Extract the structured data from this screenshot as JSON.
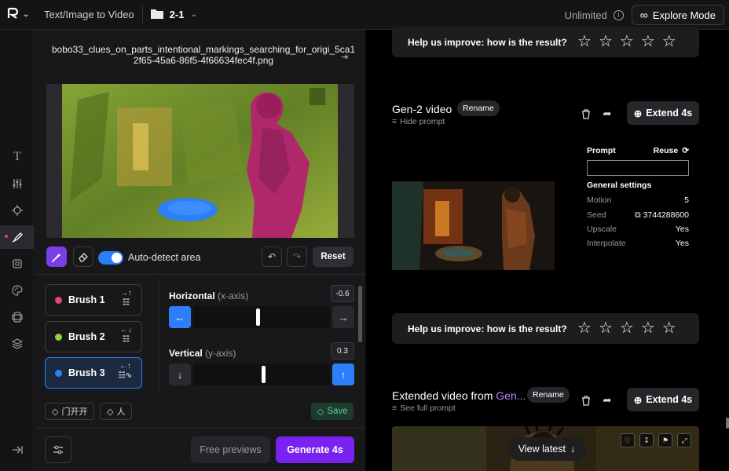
{
  "topbar": {
    "title": "Text/Image to Video",
    "folder": "2-1",
    "unlimited": "Unlimited",
    "info_glyph": "i",
    "explore": "Explore Mode"
  },
  "rail": {
    "icons": [
      "text-icon",
      "sliders-icon",
      "camera-motion-icon",
      "motion-brush-icon",
      "frame-icon",
      "palette-icon",
      "layers-stack-icon",
      "layers-icon",
      "collapse-icon"
    ]
  },
  "editor": {
    "filename": "bobo33_clues_on_parts_intentional_markings_searching_for_origi_5ca12f65-45a6-86f5-4f66634fec4f.png",
    "autodetect": "Auto-detect area",
    "reset": "Reset",
    "brushes": [
      {
        "label": "Brush 1",
        "color": "#e0457b"
      },
      {
        "label": "Brush 2",
        "color": "#8fd13a"
      },
      {
        "label": "Brush 3",
        "color": "#2d7ff9"
      }
    ],
    "horizontal": {
      "label": "Horizontal",
      "hint": "(x-axis)",
      "value": "-0.6"
    },
    "vertical": {
      "label": "Vertical",
      "hint": "(y-axis)",
      "value": "0.3"
    },
    "chips": [
      "门开开",
      "人"
    ],
    "save": "Save",
    "free_previews": "Free previews",
    "generate": "Generate 4s"
  },
  "feed": {
    "rating_question": "Help us improve: how is the result?",
    "gen2": {
      "title": "Gen-2 video",
      "rename": "Rename",
      "hide_prompt": "Hide prompt",
      "extend": "Extend 4s",
      "prompt_label": "Prompt",
      "reuse": "Reuse",
      "general": "General settings",
      "settings": [
        {
          "k": "Motion",
          "v": "5"
        },
        {
          "k": "Seed",
          "v": "3744288600"
        },
        {
          "k": "Upscale",
          "v": "Yes"
        },
        {
          "k": "Interpolate",
          "v": "Yes"
        }
      ]
    },
    "extended": {
      "title_a": "Extended video from ",
      "title_b": "Gen...",
      "rename": "Rename",
      "see_prompt": "See full prompt",
      "extend": "Extend 4s"
    },
    "view_latest": "View latest"
  },
  "colors": {
    "accent_purple": "#7a22f0",
    "accent_blue": "#2d7ff9",
    "save_green": "#4fd69a"
  }
}
